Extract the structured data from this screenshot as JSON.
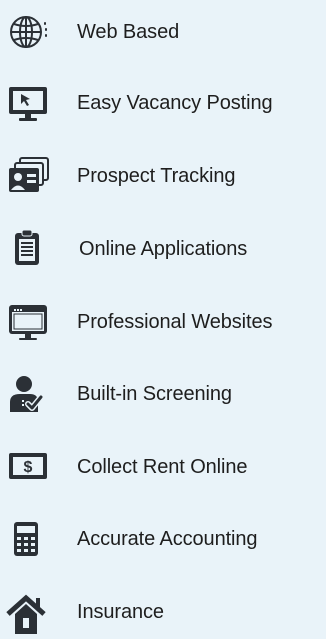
{
  "features": [
    {
      "label": "Web Based",
      "icon": "globe-icon"
    },
    {
      "label": "Easy Vacancy Posting",
      "icon": "monitor-cursor-icon"
    },
    {
      "label": "Prospect Tracking",
      "icon": "contact-cards-icon"
    },
    {
      "label": "Online Applications",
      "icon": "clipboard-icon"
    },
    {
      "label": "Professional Websites",
      "icon": "browser-window-icon"
    },
    {
      "label": "Built-in Screening",
      "icon": "user-check-icon"
    },
    {
      "label": "Collect Rent Online",
      "icon": "dollar-screen-icon"
    },
    {
      "label": "Accurate Accounting",
      "icon": "calculator-icon"
    },
    {
      "label": "Insurance",
      "icon": "house-icon"
    }
  ],
  "colors": {
    "background": "#e9f3f9",
    "icon": "#2b3036",
    "text": "#1e1e1e"
  }
}
